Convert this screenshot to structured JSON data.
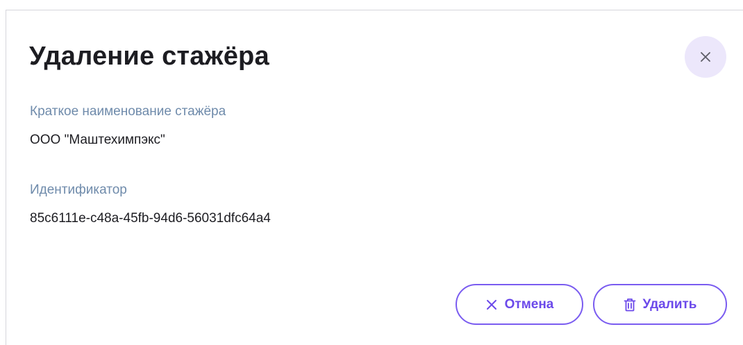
{
  "dialog": {
    "title": "Удаление стажёра",
    "close_icon": "close-icon"
  },
  "fields": {
    "short_name": {
      "label": "Краткое наименование стажёра",
      "value": "ООО \"Маштехимпэкс\""
    },
    "identifier": {
      "label": "Идентификатор",
      "value": "85c6111e-c48a-45fb-94d6-56031dfc64a4"
    }
  },
  "actions": {
    "cancel": {
      "label": "Отмена",
      "icon": "close-icon"
    },
    "delete": {
      "label": "Удалить",
      "icon": "trash-icon"
    }
  },
  "colors": {
    "accent": "#6b49ea",
    "label": "#6f8bab",
    "close_bg": "#ece7fb",
    "text": "#1d1d22"
  }
}
